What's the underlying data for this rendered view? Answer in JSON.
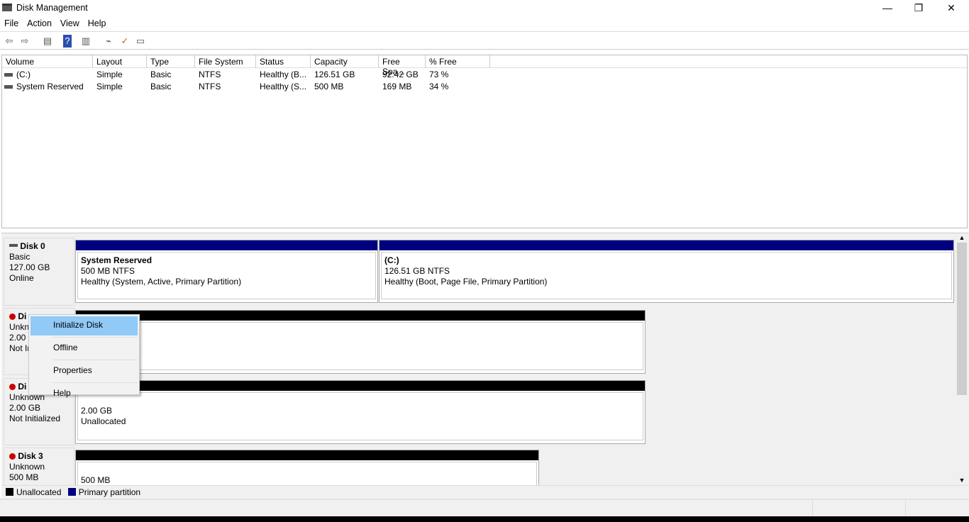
{
  "window": {
    "title": "Disk Management",
    "controls": {
      "minimize": "—",
      "restore": "❐",
      "close": "✕"
    }
  },
  "menu": [
    "File",
    "Action",
    "View",
    "Help"
  ],
  "toolbar": {
    "icons": [
      "back-icon",
      "forward-icon",
      "console-tree-icon",
      "help-icon",
      "show-hide-icon",
      "connect-icon",
      "checklist-icon",
      "properties-icon"
    ]
  },
  "volumes": {
    "columns": [
      "Volume",
      "Layout",
      "Type",
      "File System",
      "Status",
      "Capacity",
      "Free Spa...",
      "% Free"
    ],
    "rows": [
      [
        "(C:)",
        "Simple",
        "Basic",
        "NTFS",
        "Healthy (B...",
        "126.51 GB",
        "92.42 GB",
        "73 %"
      ],
      [
        "System Reserved",
        "Simple",
        "Basic",
        "NTFS",
        "Healthy (S...",
        "500 MB",
        "169 MB",
        "34 %"
      ]
    ]
  },
  "disks": [
    {
      "name": "Disk 0",
      "type": "Basic",
      "size": "127.00 GB",
      "state": "Online",
      "partitions": [
        {
          "name": "System Reserved",
          "size": "500 MB NTFS",
          "status": "Healthy (System, Active, Primary Partition)"
        },
        {
          "name": "(C:)",
          "size": "126.51 GB NTFS",
          "status": "Healthy (Boot, Page File, Primary Partition)"
        }
      ]
    },
    {
      "name": "Di",
      "type": "Unkn",
      "size": "2.00 G",
      "state": "Not In"
    },
    {
      "name": "Di",
      "type": "Unknown",
      "size": "2.00 GB",
      "state": "Not Initialized",
      "partition": {
        "size": "2.00 GB",
        "status": "Unallocated"
      }
    },
    {
      "name": "Disk 3",
      "type": "Unknown",
      "size": "500 MB",
      "partition": {
        "size": "500 MB"
      }
    }
  ],
  "context_menu": [
    "Initialize Disk",
    "Offline",
    "Properties",
    "Help"
  ],
  "legend": [
    {
      "label": "Unallocated",
      "color": "#000000"
    },
    {
      "label": "Primary partition",
      "color": "#000080"
    }
  ],
  "colors": {
    "primary": "#000080",
    "unallocated": "#000000",
    "menu_highlight": "#91c9f7"
  }
}
